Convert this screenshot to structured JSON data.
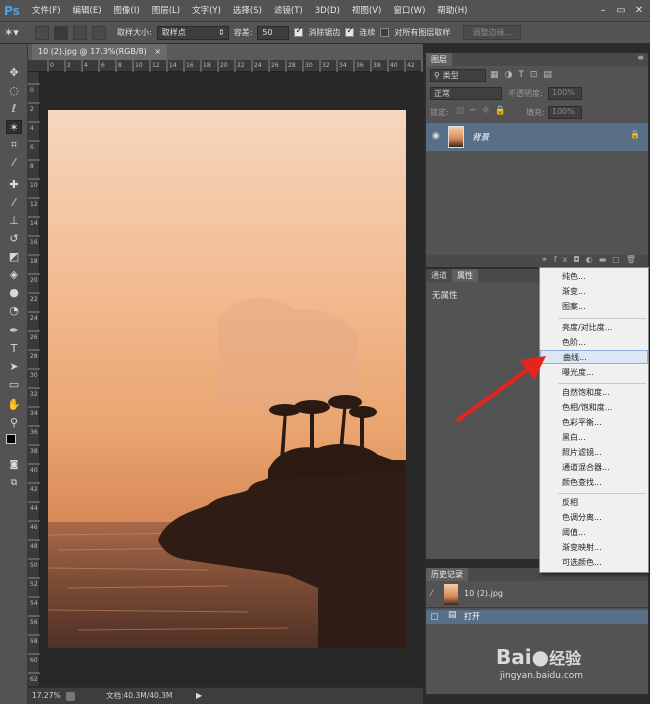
{
  "app": {
    "logo": "Ps"
  },
  "menubar": {
    "items": [
      "文件(F)",
      "编辑(E)",
      "图像(I)",
      "图层(L)",
      "文字(Y)",
      "选择(S)",
      "滤镜(T)",
      "3D(D)",
      "视图(V)",
      "窗口(W)",
      "帮助(H)"
    ],
    "minimize": "–",
    "restore": "▭",
    "close": "✕"
  },
  "options": {
    "sample_size_label": "取样大小:",
    "sample_size_value": "取样点",
    "tolerance_label": "容差:",
    "tolerance_value": "50",
    "antialias_label": "消除锯齿",
    "contiguous_label": "连续",
    "all_layers_label": "对所有图层取样",
    "refine_edge_label": "调整边缘..."
  },
  "document": {
    "tab_title": "10 (2).jpg @ 17.3%(RGB/8)",
    "tab_close": "×",
    "zoom": "17.27%",
    "doc_info": "文档:40.3M/40.3M"
  },
  "ruler_h": [
    "0",
    "2",
    "4",
    "6",
    "8",
    "10",
    "12",
    "14",
    "16",
    "18",
    "20",
    "22",
    "24",
    "26",
    "28",
    "30",
    "32",
    "34",
    "36",
    "38",
    "40",
    "42",
    "44"
  ],
  "ruler_v": [
    "0",
    "2",
    "4",
    "6",
    "8",
    "10",
    "12",
    "14",
    "16",
    "18",
    "20",
    "22",
    "24",
    "26",
    "28",
    "30",
    "32",
    "34",
    "36",
    "38",
    "40",
    "42",
    "44",
    "46",
    "48",
    "50",
    "52",
    "54",
    "56",
    "58",
    "60",
    "62"
  ],
  "layers_panel": {
    "tab": "图层",
    "filter_kind": "类型",
    "blend_mode": "正常",
    "opacity_label": "不透明度:",
    "opacity_value": "100%",
    "lock_label": "锁定:",
    "fill_label": "填充:",
    "fill_value": "100%",
    "layer_name": "背景"
  },
  "props_panel": {
    "tabs": [
      "通道",
      "属性"
    ],
    "content": "无属性"
  },
  "history_panel": {
    "tab": "历史记录",
    "snapshot": "10 (2).jpg",
    "steps": [
      "打开"
    ]
  },
  "adjust_menu": {
    "items": [
      "纯色...",
      "渐变...",
      "图案...",
      "亮度/对比度...",
      "色阶...",
      "曲线...",
      "曝光度...",
      "自然饱和度...",
      "色相/饱和度...",
      "色彩平衡...",
      "黑白...",
      "照片滤镜...",
      "通道混合器...",
      "颜色查找...",
      "反相",
      "色调分离...",
      "阈值...",
      "渐变映射...",
      "可选颜色..."
    ],
    "highlighted": "曲线..."
  },
  "watermark": {
    "brand": "Bai",
    "brand2": "经验",
    "url": "jingyan.baidu.com"
  },
  "colors": {
    "arrow": "#e8231e",
    "panel_bg": "#535353",
    "selected_row": "#596f87"
  }
}
